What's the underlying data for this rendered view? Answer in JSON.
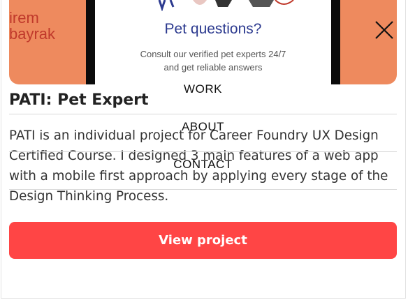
{
  "header": {
    "brand_line1": "irem",
    "brand_line2": "bayrak"
  },
  "mockup": {
    "title": "Pet questions?",
    "subtitle_line1": "Consult our verified pet experts 24/7",
    "subtitle_line2": "and get reliable answers"
  },
  "nav": {
    "close_icon": "close-icon",
    "items": [
      {
        "label": "WORK"
      },
      {
        "label": "ABOUT"
      },
      {
        "label": "CONTACT"
      }
    ]
  },
  "project": {
    "title": "PATI: Pet Expert",
    "description": "PATI is an individual project for Career Foundry UX Design Certified Course. I designed 3 main features of a web app with a mobile first approach by applying every stage of the Design Thinking Process.",
    "button_label": "View project"
  },
  "colors": {
    "card_bg": "#ee8a5e",
    "accent_button": "#ff4545",
    "mockup_title": "#2c3a8f"
  }
}
